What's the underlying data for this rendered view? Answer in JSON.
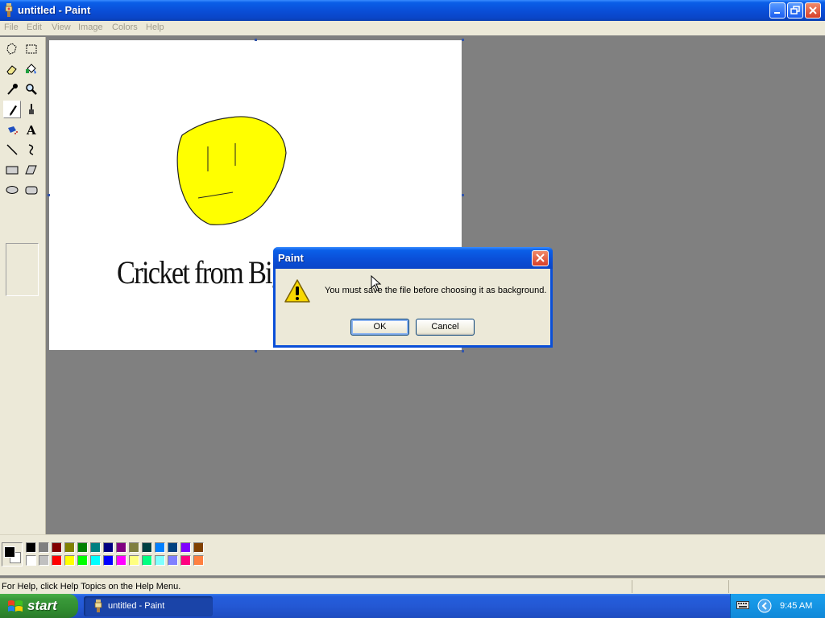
{
  "window": {
    "title": "untitled - Paint"
  },
  "menu": {
    "items": [
      "File",
      "Edit",
      "View",
      "Image",
      "Colors",
      "Help"
    ]
  },
  "toolbox": {
    "tools": [
      "free-form-select",
      "rectangle-select",
      "eraser",
      "fill-bucket",
      "color-picker",
      "magnifier",
      "pencil",
      "brush",
      "airbrush",
      "text",
      "line",
      "curve",
      "rectangle",
      "polygon",
      "ellipse",
      "rounded-rectangle"
    ],
    "active_tool": "pencil"
  },
  "canvas": {
    "text": "Cricket from Big",
    "face_fill": "#ffff00"
  },
  "palette": {
    "foreground": "#000000",
    "background": "#ffffff",
    "top_row": [
      "#000000",
      "#808080",
      "#800000",
      "#808000",
      "#008000",
      "#008080",
      "#000080",
      "#800080",
      "#808040",
      "#004040",
      "#0080ff",
      "#004080",
      "#8000ff",
      "#804000"
    ],
    "bottom_row": [
      "#ffffff",
      "#c0c0c0",
      "#ff0000",
      "#ffff00",
      "#00ff00",
      "#00ffff",
      "#0000ff",
      "#ff00ff",
      "#ffff80",
      "#00ff80",
      "#80ffff",
      "#8080ff",
      "#ff0080",
      "#ff8040"
    ]
  },
  "status": {
    "help_text": "For Help, click Help Topics on the Help Menu."
  },
  "dialog": {
    "title": "Paint",
    "message": "You must save the file before choosing it as background.",
    "ok_label": "OK",
    "cancel_label": "Cancel",
    "icon": "warning-icon"
  },
  "taskbar": {
    "start_label": "start",
    "task_label": "untitled - Paint",
    "clock": "9:45 AM"
  }
}
